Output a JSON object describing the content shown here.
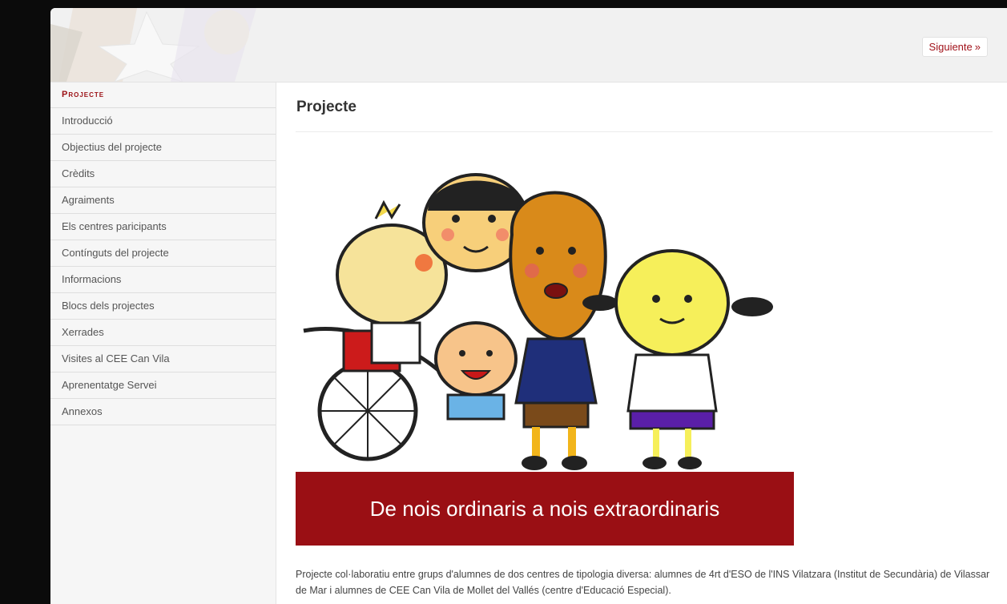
{
  "header": {
    "next_label": "Siguiente",
    "next_arrow": "»"
  },
  "sidebar": {
    "title": "Projecte",
    "items": [
      {
        "label": "Introducció"
      },
      {
        "label": "Objectius del projecte"
      },
      {
        "label": "Crèdits"
      },
      {
        "label": "Agraiments"
      },
      {
        "label": "Els centres paricipants"
      },
      {
        "label": "Contínguts del projecte"
      },
      {
        "label": "Informacions"
      },
      {
        "label": "Blocs dels projectes"
      },
      {
        "label": "Xerrades"
      },
      {
        "label": "Visites al CEE Can Vila"
      },
      {
        "label": "Aprenentatge Servei"
      },
      {
        "label": "Annexos"
      }
    ]
  },
  "main": {
    "title": "Projecte",
    "banner_caption": "De nois ordinaris a nois extraordinaris",
    "description": "Projecte col·laboratiu entre grups d'alumnes de dos centres de tipologia diversa: alumnes de 4rt d'ESO de l'INS Vilatzara (Institut de Secundària) de Vilassar de Mar i alumnes de CEE Can Vila de Mollet del Vallés (centre d'Educació Especial)."
  },
  "colors": {
    "accent": "#9a0f14",
    "background": "#0b0b0b"
  }
}
